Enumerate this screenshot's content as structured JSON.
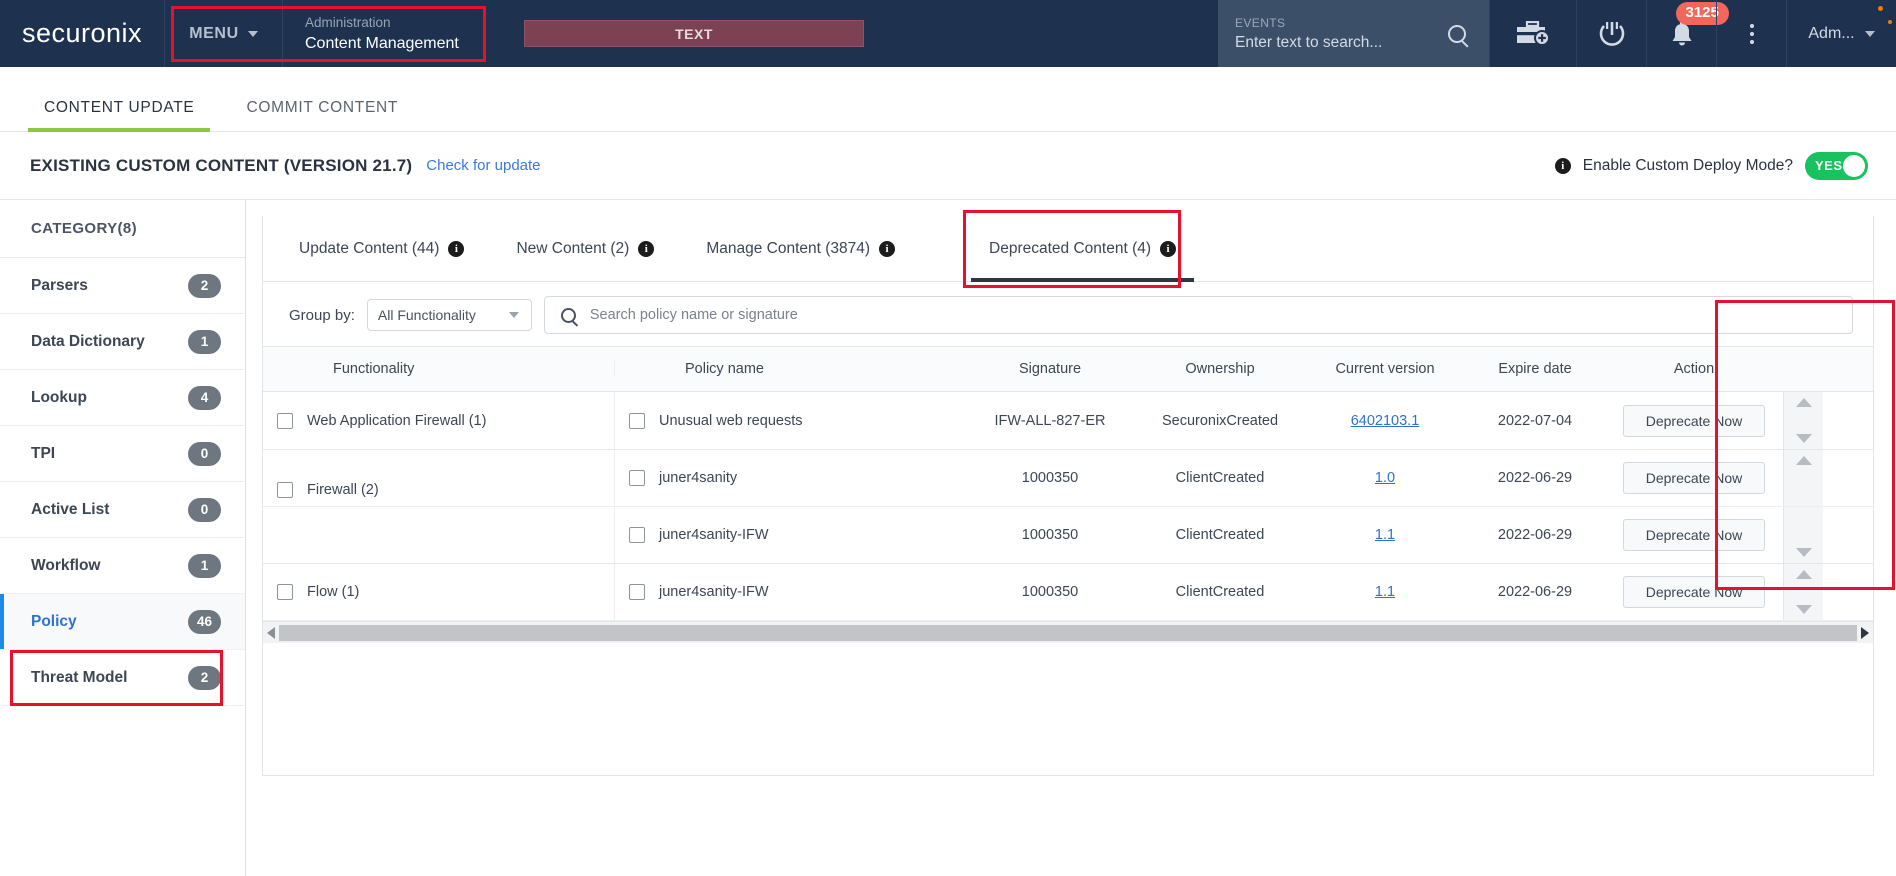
{
  "topnav": {
    "brand": "securonix",
    "menu_label": "MENU",
    "breadcrumb_top": "Administration",
    "breadcrumb_bottom": "Content Management",
    "text_banner": "TEXT",
    "search": {
      "label": "EVENTS",
      "placeholder": "Enter text to search...",
      "value": "Enter text to search..."
    },
    "icons": {
      "briefcase_add": "briefcase-add-icon",
      "power": "power-icon",
      "bell": "bell-icon",
      "kebab": "kebab-menu-icon"
    },
    "notification_count": "3125",
    "user_label": "Adm..."
  },
  "page_tabs": [
    {
      "label": "CONTENT UPDATE",
      "active": true
    },
    {
      "label": "COMMIT CONTENT",
      "active": false
    }
  ],
  "title_row": {
    "title": "EXISTING CUSTOM CONTENT (VERSION 21.7)",
    "check_update_link": "Check for update",
    "deploy_label": "Enable Custom Deploy Mode?",
    "toggle_value": "YES"
  },
  "sidebar": {
    "heading": "CATEGORY(8)",
    "items": [
      {
        "label": "Parsers",
        "count": "2",
        "selected": false
      },
      {
        "label": "Data Dictionary",
        "count": "1",
        "selected": false
      },
      {
        "label": "Lookup",
        "count": "4",
        "selected": false
      },
      {
        "label": "TPI",
        "count": "0",
        "selected": false
      },
      {
        "label": "Active List",
        "count": "0",
        "selected": false
      },
      {
        "label": "Workflow",
        "count": "1",
        "selected": false
      },
      {
        "label": "Policy",
        "count": "46",
        "selected": true
      },
      {
        "label": "Threat Model",
        "count": "2",
        "selected": false
      }
    ]
  },
  "content_tabs": [
    {
      "label": "Update Content (44)",
      "active": false
    },
    {
      "label": "New Content (2)",
      "active": false
    },
    {
      "label": "Manage Content (3874)",
      "active": false
    },
    {
      "label": "Deprecated Content (4)",
      "active": true
    }
  ],
  "filters": {
    "group_by_label": "Group by:",
    "group_by_value": "All Functionality",
    "search_placeholder": "Search policy name or signature"
  },
  "table": {
    "columns": [
      "Functionality",
      "Policy name",
      "Signature",
      "Ownership",
      "Current version",
      "Expire date",
      "Action"
    ],
    "action_button_label": "Deprecate Now",
    "rows": [
      {
        "functionality": "Web Application Firewall (1)",
        "policy_name": "Unusual web requests",
        "signature": "IFW-ALL-827-ER",
        "ownership": "SecuronixCreated",
        "current_version": "6402103.1",
        "expire_date": "2022-07-04",
        "action": "Deprecate Now",
        "group_start": true,
        "group_rows": 1
      },
      {
        "functionality": "Firewall (2)",
        "policy_name": "juner4sanity",
        "signature": "1000350",
        "ownership": "ClientCreated",
        "current_version": "1.0",
        "expire_date": "2022-06-29",
        "action": "Deprecate Now",
        "group_start": true,
        "group_rows": 2
      },
      {
        "functionality": "",
        "policy_name": "juner4sanity-IFW",
        "signature": "1000350",
        "ownership": "ClientCreated",
        "current_version": "1.1",
        "expire_date": "2022-06-29",
        "action": "Deprecate Now",
        "group_start": false,
        "group_rows": 0
      },
      {
        "functionality": "Flow (1)",
        "policy_name": "juner4sanity-IFW",
        "signature": "1000350",
        "ownership": "ClientCreated",
        "current_version": "1.1",
        "expire_date": "2022-06-29",
        "action": "Deprecate Now",
        "group_start": true,
        "group_rows": 1
      }
    ]
  },
  "colors": {
    "nav_bg": "#1e3250",
    "accent_green": "#8cc63f",
    "toggle_green": "#19c25e",
    "highlight_red": "#e8112d",
    "link_blue": "#2d72d2",
    "badge_red": "#f2675b",
    "banner_maroon": "#7c4253"
  }
}
